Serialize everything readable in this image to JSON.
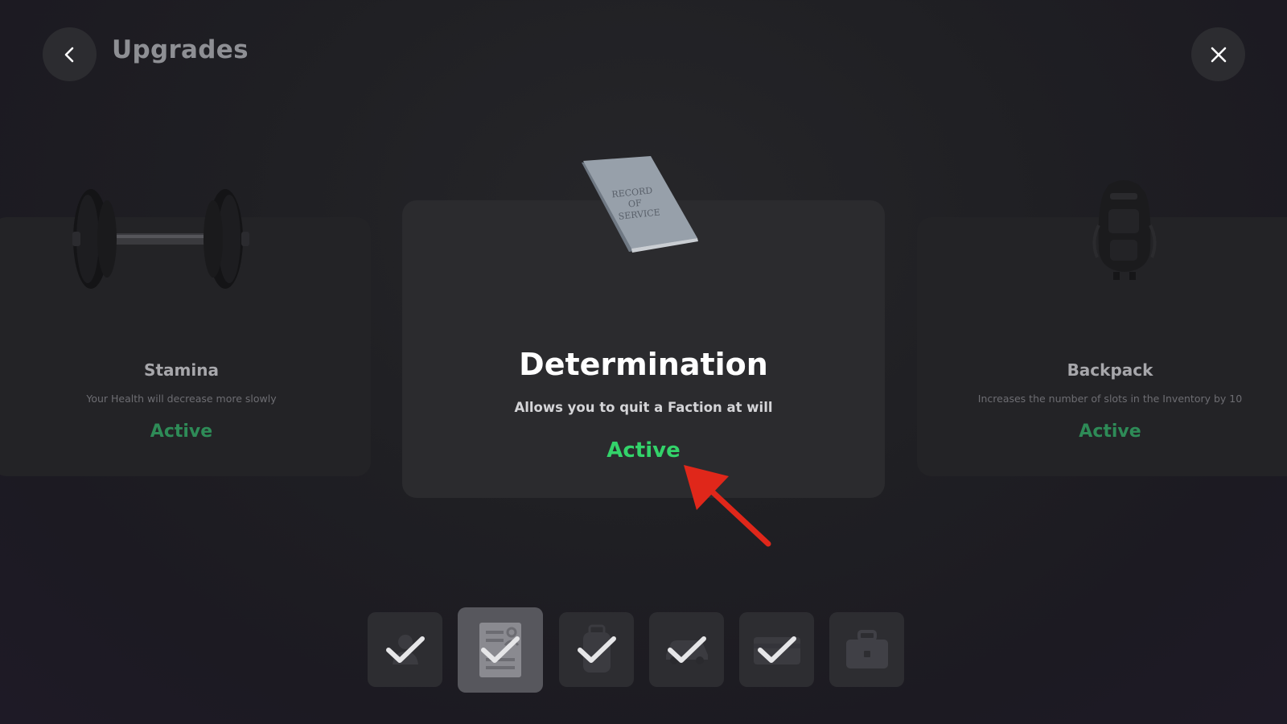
{
  "header": {
    "title": "Upgrades",
    "back_icon": "chevron-left-icon",
    "close_icon": "close-icon"
  },
  "cards": {
    "left": {
      "name": "Stamina",
      "description": "Your Health will decrease more slowly",
      "status": "Active",
      "image": "dumbbell"
    },
    "center": {
      "name": "Determination",
      "description": "Allows you to quit a Faction at will",
      "status": "Active",
      "image": "record-of-service-book",
      "image_text": "RECORD OF SERVICE"
    },
    "right": {
      "name": "Backpack",
      "description": "Increases the number of slots in the Inventory by 10",
      "status": "Active",
      "image": "backpack"
    }
  },
  "thumbnails": [
    {
      "icon": "person-icon",
      "checked": true,
      "selected": false
    },
    {
      "icon": "document-icon",
      "checked": true,
      "selected": true
    },
    {
      "icon": "backpack-icon",
      "checked": true,
      "selected": false
    },
    {
      "icon": "car-icon",
      "checked": true,
      "selected": false
    },
    {
      "icon": "card-icon",
      "checked": true,
      "selected": false
    },
    {
      "icon": "briefcase-icon",
      "checked": false,
      "selected": false
    }
  ],
  "colors": {
    "active_green": "#33d36a",
    "active_green_dim": "#2e8b57",
    "annotation_arrow": "#e0271a"
  }
}
